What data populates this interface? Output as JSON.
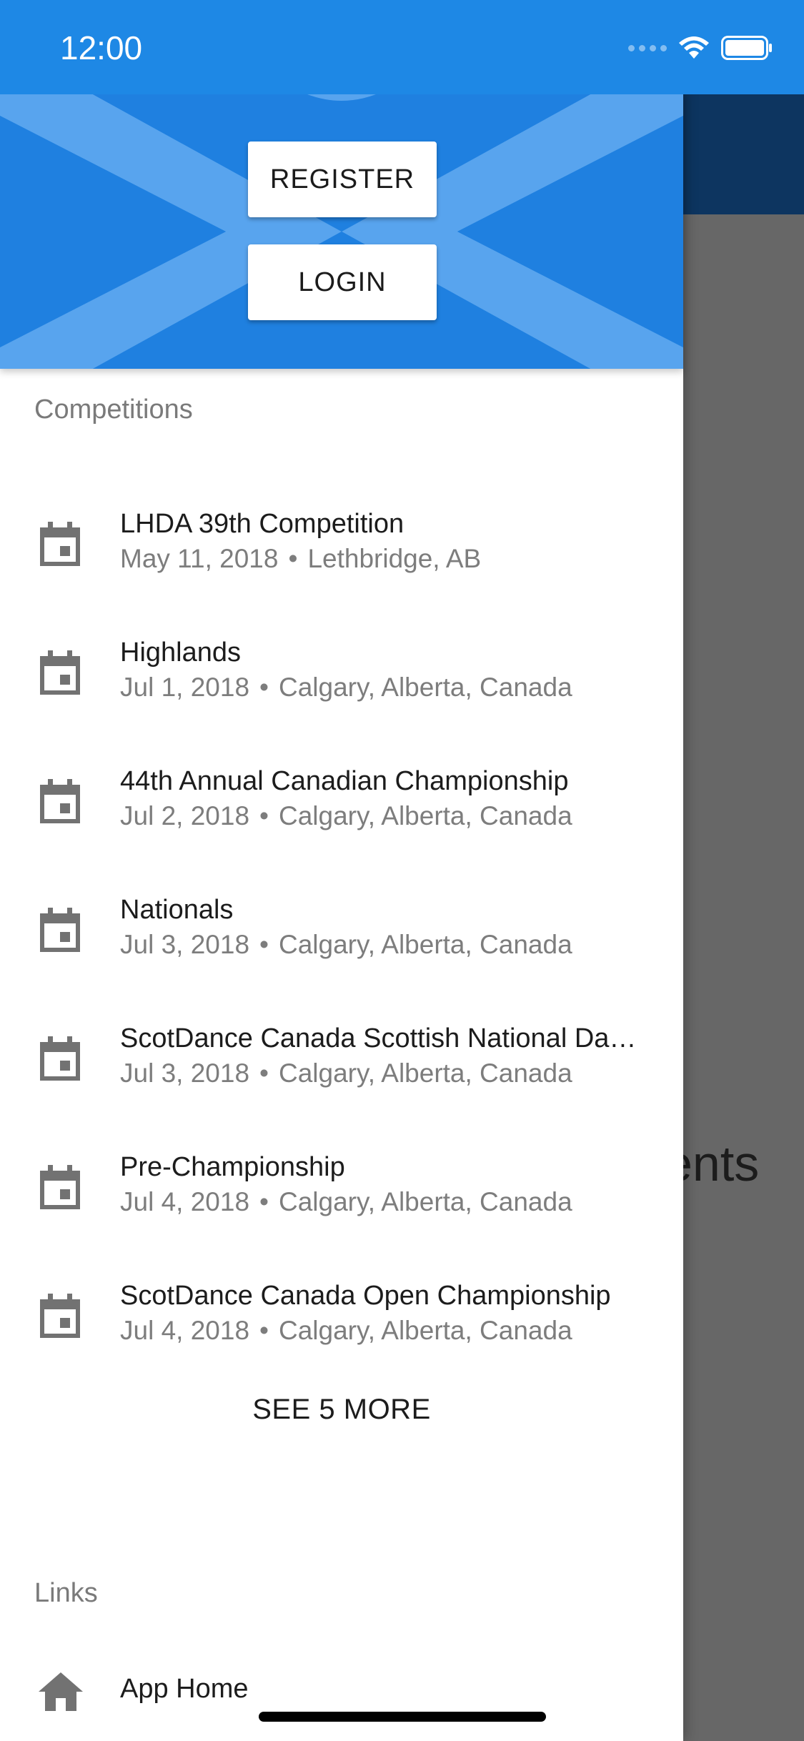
{
  "status_bar": {
    "time": "12:00"
  },
  "background": {
    "partial_text": "ents"
  },
  "header": {
    "register_label": "REGISTER",
    "login_label": "LOGIN"
  },
  "competitions": {
    "title": "Competitions",
    "items": [
      {
        "name": "LHDA 39th Competition",
        "date": "May 11, 2018",
        "location": "Lethbridge, AB"
      },
      {
        "name": "Highlands",
        "date": "Jul 1, 2018",
        "location": "Calgary, Alberta, Canada"
      },
      {
        "name": "44th Annual Canadian Championship",
        "date": "Jul 2, 2018",
        "location": "Calgary, Alberta, Canada"
      },
      {
        "name": "Nationals",
        "date": "Jul 3, 2018",
        "location": "Calgary, Alberta, Canada"
      },
      {
        "name": "ScotDance Canada Scottish National Da…",
        "date": "Jul 3, 2018",
        "location": "Calgary, Alberta, Canada"
      },
      {
        "name": "Pre-Championship",
        "date": "Jul 4, 2018",
        "location": "Calgary, Alberta, Canada"
      },
      {
        "name": "ScotDance Canada Open Championship",
        "date": "Jul 4, 2018",
        "location": "Calgary, Alberta, Canada"
      }
    ],
    "separator": "•",
    "see_more_label": "SEE 5 MORE"
  },
  "links": {
    "title": "Links",
    "items": [
      {
        "label": "App Home",
        "icon": "home-icon"
      }
    ]
  },
  "colors": {
    "primary": "#1e88e5",
    "header_dark": "#0d3560",
    "scrim": "#676767"
  }
}
